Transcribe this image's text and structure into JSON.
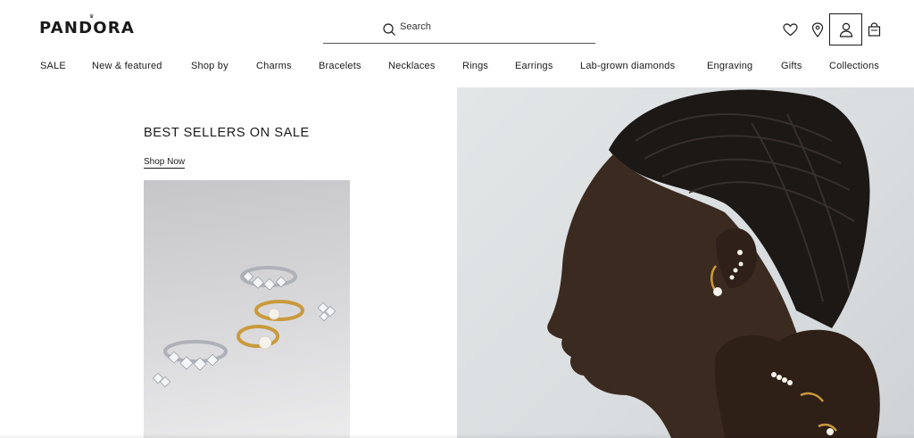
{
  "brand": {
    "logo_text": "PANDORA"
  },
  "search": {
    "placeholder": "Search",
    "icon": "search-icon"
  },
  "header_icons": [
    "heart-icon",
    "location-pin-icon",
    "account-icon",
    "shopping-bag-icon"
  ],
  "nav": {
    "items": [
      {
        "label": "SALE"
      },
      {
        "label": "New & featured"
      },
      {
        "label": "Shop by"
      },
      {
        "label": "Charms"
      },
      {
        "label": "Bracelets"
      },
      {
        "label": "Necklaces"
      },
      {
        "label": "Rings"
      },
      {
        "label": "Earrings"
      },
      {
        "label": "Lab-grown diamonds"
      },
      {
        "label": "Engraving"
      },
      {
        "label": "Gifts"
      },
      {
        "label": "Collections"
      }
    ]
  },
  "hero": {
    "title": "BEST SELLERS ON SALE",
    "cta_label": "Shop Now"
  },
  "colors": {
    "text": "#1a1a1a",
    "gold": "#c99a3c",
    "silver": "#b8bcc2"
  }
}
